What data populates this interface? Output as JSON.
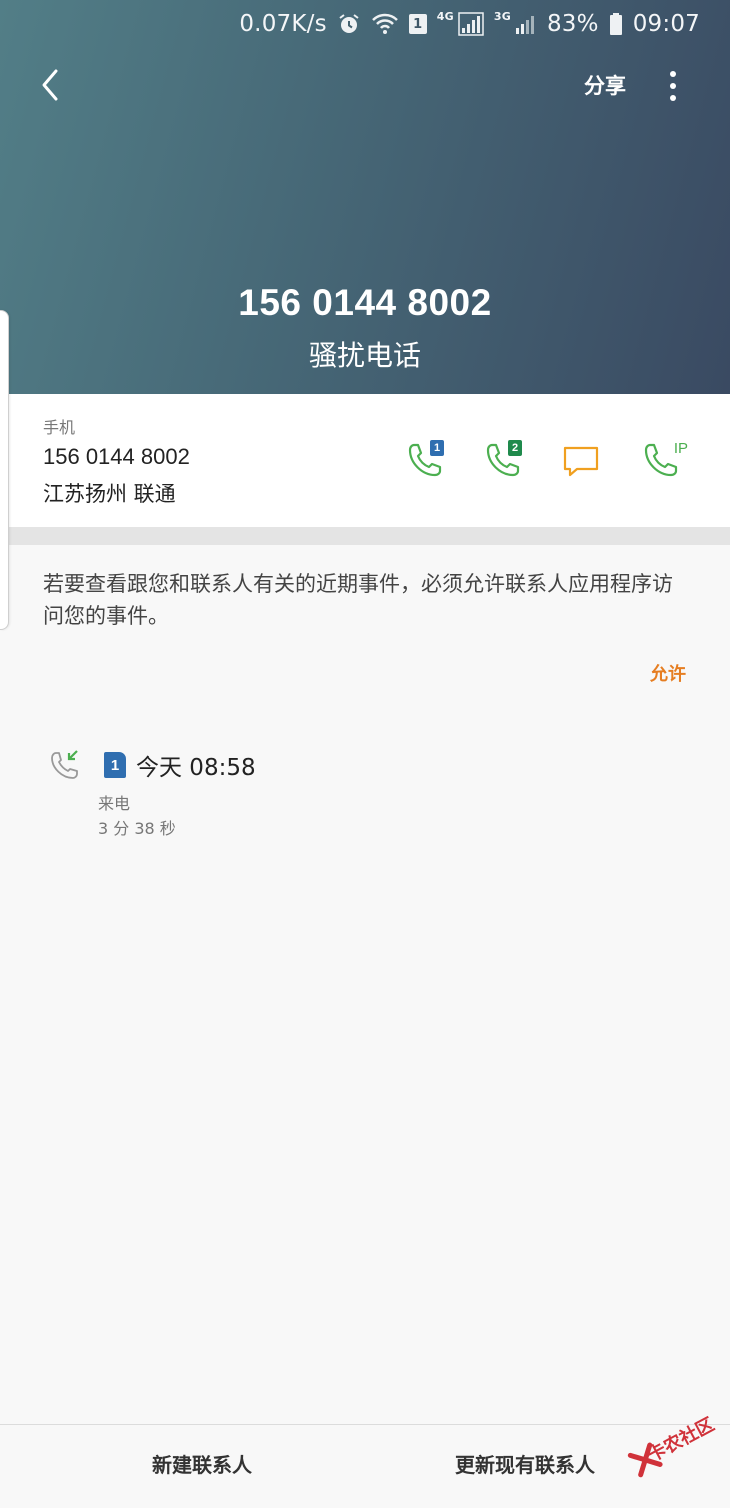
{
  "status_bar": {
    "speed": "0.07K/s",
    "sim_slot": "1",
    "net1": "4G",
    "net2": "3G",
    "battery": "83%",
    "time": "09:07"
  },
  "toolbar": {
    "share_label": "分享"
  },
  "hero": {
    "number": "156 0144 8002",
    "tag": "骚扰电话"
  },
  "number_card": {
    "type_label": "手机",
    "number": "156 0144 8002",
    "location": "江苏扬州 联通",
    "actions": [
      {
        "name": "call-sim1",
        "badge": "1",
        "color": "#2f6eb0"
      },
      {
        "name": "call-sim2",
        "badge": "2",
        "color": "#1f8a4c"
      },
      {
        "name": "message"
      },
      {
        "name": "ip-call",
        "badge": "IP"
      }
    ]
  },
  "notice": {
    "text": "若要查看跟您和联系人有关的近期事件，必须允许联系人应用程序访问您的事件。",
    "allow_label": "允许"
  },
  "call_log": [
    {
      "sim": "1",
      "time": "今天 08:58",
      "type": "来电",
      "duration": "3 分 38 秒"
    }
  ],
  "bottom_bar": {
    "new_contact": "新建联系人",
    "update_contact": "更新现有联系人"
  },
  "watermark": {
    "text": "卡农社区"
  },
  "colors": {
    "accent_green": "#4caf50",
    "message_yellow": "#f0a020",
    "allow_orange": "#e67e22",
    "sim_blue": "#2f6eb0",
    "sim_green": "#1f8a4c"
  }
}
